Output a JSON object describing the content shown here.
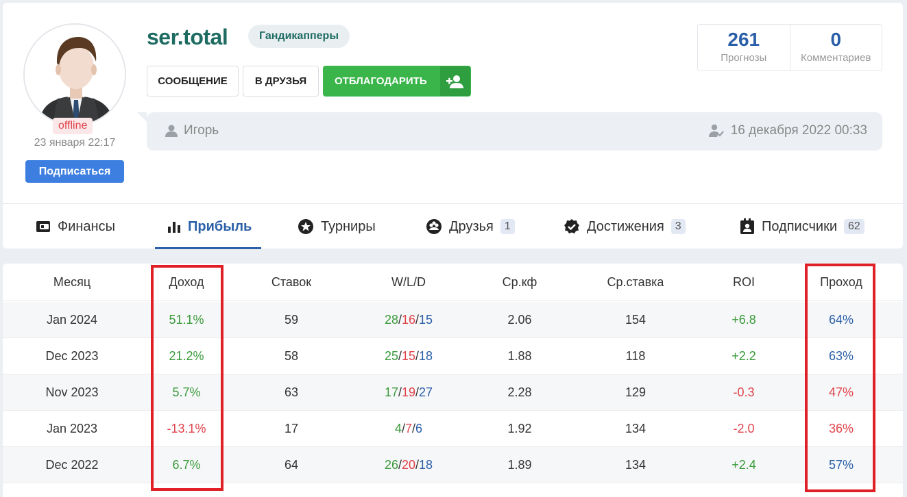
{
  "profile": {
    "username": "ser.total",
    "group": "Гандикапперы",
    "status": "offline",
    "last_seen": "23 января 22:17",
    "subscribe_label": "Подписаться",
    "buttons": {
      "message": "СООБЩЕНИЕ",
      "friend": "В ДРУЗЬЯ",
      "thank": "ОТБЛАГОДАРИТЬ"
    },
    "stats": [
      {
        "value": "261",
        "label": "Прогнозы"
      },
      {
        "value": "0",
        "label": "Комментариев"
      }
    ],
    "info": {
      "name": "Игорь",
      "date": "16 декабря 2022 00:33"
    }
  },
  "tabs": [
    {
      "label": "Финансы",
      "icon": "wallet-icon"
    },
    {
      "label": "Прибыль",
      "icon": "bar-chart-icon",
      "active": true
    },
    {
      "label": "Турниры",
      "icon": "star-icon"
    },
    {
      "label": "Друзья",
      "icon": "group-icon",
      "count": "1"
    },
    {
      "label": "Достижения",
      "icon": "badge-check-icon",
      "count": "3"
    },
    {
      "label": "Подписчики",
      "icon": "contact-card-icon",
      "count": "62"
    }
  ],
  "table": {
    "headers": [
      "Месяц",
      "Доход",
      "Ставок",
      "W/L/D",
      "Ср.кф",
      "Ср.ставка",
      "ROI",
      "Проход"
    ],
    "rows": [
      {
        "month": "Jan 2024",
        "income": "51.1%",
        "bets": "59",
        "w": "28",
        "l": "16",
        "d": "15",
        "avg_k": "2.06",
        "avg_stake": "154",
        "roi": "+6.8",
        "pass": "64%"
      },
      {
        "month": "Dec 2023",
        "income": "21.2%",
        "bets": "58",
        "w": "25",
        "l": "15",
        "d": "18",
        "avg_k": "1.88",
        "avg_stake": "118",
        "roi": "+2.2",
        "pass": "63%"
      },
      {
        "month": "Nov 2023",
        "income": "5.7%",
        "bets": "63",
        "w": "17",
        "l": "19",
        "d": "27",
        "avg_k": "2.28",
        "avg_stake": "129",
        "roi": "-0.3",
        "pass": "47%"
      },
      {
        "month": "Jan 2023",
        "income": "-13.1%",
        "bets": "17",
        "w": "4",
        "l": "7",
        "d": "6",
        "avg_k": "1.92",
        "avg_stake": "134",
        "roi": "-2.0",
        "pass": "36%"
      },
      {
        "month": "Dec 2022",
        "income": "6.7%",
        "bets": "64",
        "w": "26",
        "l": "20",
        "d": "18",
        "avg_k": "1.89",
        "avg_stake": "134",
        "roi": "+2.4",
        "pass": "57%"
      }
    ]
  },
  "colors": {
    "positive": "#3a9a3a",
    "negative": "#e0434b",
    "accent": "#2b5fa8",
    "highlight": "#e01f26"
  }
}
